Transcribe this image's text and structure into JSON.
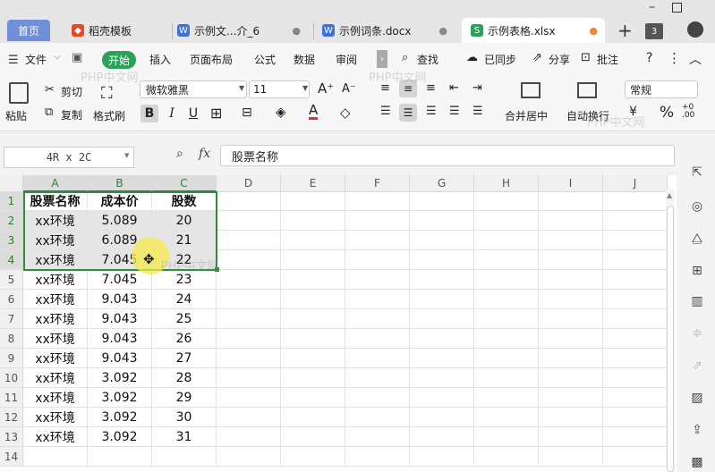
{
  "tabs": {
    "home": "首页",
    "items": [
      {
        "label": "稻壳模板",
        "icon": "docer-icon",
        "color": "#e34a2b"
      },
      {
        "label": "示例文...介_6",
        "icon": "word-doc-icon",
        "color": "#3b73d9"
      },
      {
        "label": "示例词条.docx",
        "icon": "word-doc-icon",
        "color": "#3b73d9"
      },
      {
        "label": "示例表格.xlsx",
        "icon": "sheet-icon",
        "color": "#2ba25a"
      }
    ],
    "add": "+",
    "count": "3"
  },
  "menu": {
    "file": "文件",
    "start": "开始",
    "items": [
      "插入",
      "页面布局",
      "公式",
      "数据",
      "审阅"
    ],
    "search": "查找",
    "synced": "已同步",
    "share": "分享",
    "annotate": "批注"
  },
  "toolbar": {
    "paste": "粘贴",
    "cut": "剪切",
    "copy": "复制",
    "format_painter": "格式刷",
    "font_name": "微软雅黑",
    "font_size": "11",
    "merge_center": "合并居中",
    "wrap_text": "自动换行",
    "number_format": "常规",
    "bold": "B",
    "italic": "I",
    "underline": "U",
    "font_color_letter": "A",
    "percent": "%"
  },
  "formula_bar": {
    "name_box": "4R x 2C",
    "fx": "fx",
    "content": "股票名称"
  },
  "columns": [
    "A",
    "B",
    "C",
    "D",
    "E",
    "F",
    "G",
    "H",
    "I",
    "J"
  ],
  "rows": [
    {
      "num": "1",
      "a": "股票名称",
      "b": "成本价",
      "c": "股数"
    },
    {
      "num": "2",
      "a": "xx环境",
      "b": "5.089",
      "c": "20"
    },
    {
      "num": "3",
      "a": "xx环境",
      "b": "6.089",
      "c": "21"
    },
    {
      "num": "4",
      "a": "xx环境",
      "b": "7.045",
      "c": "22"
    },
    {
      "num": "5",
      "a": "xx环境",
      "b": "7.045",
      "c": "23"
    },
    {
      "num": "6",
      "a": "xx环境",
      "b": "9.043",
      "c": "24"
    },
    {
      "num": "7",
      "a": "xx环境",
      "b": "9.043",
      "c": "25"
    },
    {
      "num": "8",
      "a": "xx环境",
      "b": "9.043",
      "c": "26"
    },
    {
      "num": "9",
      "a": "xx环境",
      "b": "9.043",
      "c": "27"
    },
    {
      "num": "10",
      "a": "xx环境",
      "b": "3.092",
      "c": "28"
    },
    {
      "num": "11",
      "a": "xx环境",
      "b": "3.092",
      "c": "29"
    },
    {
      "num": "12",
      "a": "xx环境",
      "b": "3.092",
      "c": "30"
    },
    {
      "num": "13",
      "a": "xx环境",
      "b": "3.092",
      "c": "31"
    },
    {
      "num": "14",
      "a": "",
      "b": "",
      "c": ""
    }
  ],
  "watermark": "PHP中文网",
  "colors": {
    "accent_green": "#2e7d32",
    "selection_border": "#2f8f3f",
    "home_tab": "#6f8fd8",
    "cursor_highlight": "#f5e94a"
  }
}
